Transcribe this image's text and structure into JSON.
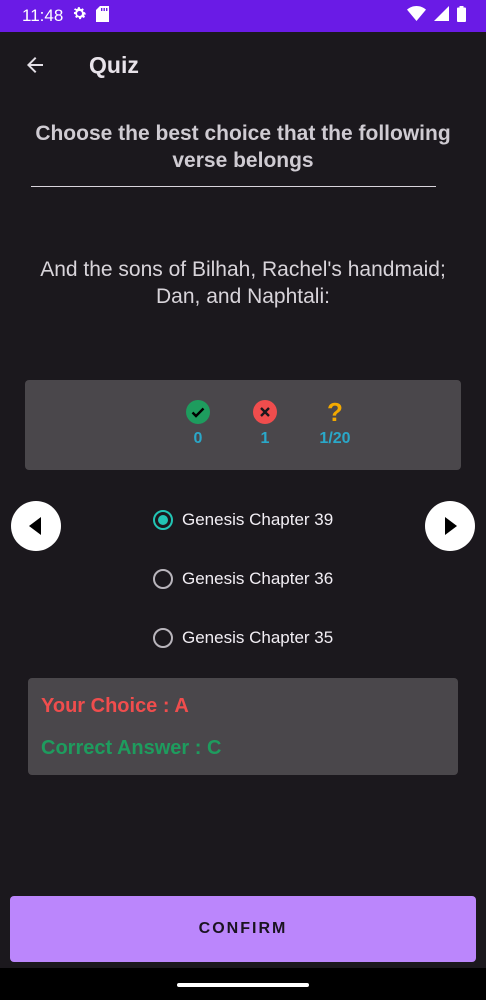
{
  "status_bar": {
    "time": "11:48"
  },
  "app_bar": {
    "title": "Quiz"
  },
  "question": {
    "heading": "Choose the best choice that the following verse belongs",
    "verse": "And the sons of Bilhah, Rachel's handmaid; Dan, and Naphtali:"
  },
  "score": {
    "correct": "0",
    "wrong": "1",
    "progress": "1/20"
  },
  "options": [
    {
      "label": "Genesis Chapter 39",
      "selected": true
    },
    {
      "label": "Genesis Chapter 36",
      "selected": false
    },
    {
      "label": "Genesis Chapter 35",
      "selected": false
    }
  ],
  "result": {
    "your_choice": "Your Choice : A",
    "correct_answer": "Correct Answer : C"
  },
  "confirm_label": "CONFIRM",
  "colors": {
    "status_bar": "#6a1be6",
    "accent": "#bb86fc",
    "radio_checked": "#22c4b4",
    "correct_icon": "#1e9c5e",
    "wrong_icon": "#f04d4d",
    "progress_icon": "#f2a900",
    "score_value": "#2aa8c9"
  }
}
